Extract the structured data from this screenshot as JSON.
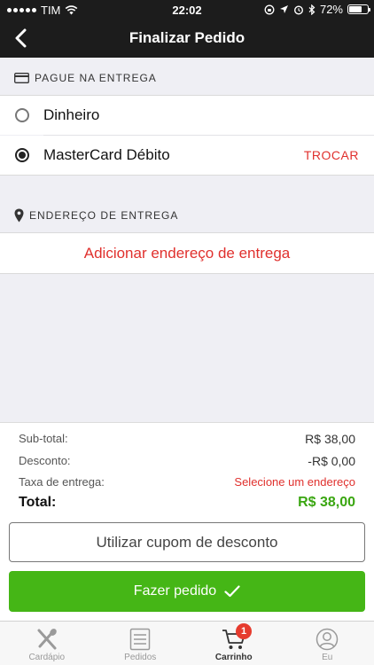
{
  "status_bar": {
    "carrier": "TIM",
    "time": "22:02",
    "battery": "72%",
    "battery_level": 0.72
  },
  "header": {
    "title": "Finalizar Pedido",
    "back_icon": "chevron-left-icon"
  },
  "payment": {
    "section_title": "PAGUE NA ENTREGA",
    "section_icon": "credit-card-icon",
    "options": [
      {
        "label": "Dinheiro",
        "selected": false
      },
      {
        "label": "MasterCard Débito",
        "selected": true,
        "action": "TROCAR"
      }
    ]
  },
  "address": {
    "section_title": "ENDEREÇO DE ENTREGA",
    "section_icon": "map-pin-icon",
    "add_label": "Adicionar endereço de entrega"
  },
  "summary": {
    "subtotal_label": "Sub-total:",
    "subtotal_value": "R$ 38,00",
    "discount_label": "Desconto:",
    "discount_value": "-R$ 0,00",
    "delivery_label": "Taxa de entrega:",
    "delivery_value": "Selecione um endereço",
    "total_label": "Total:",
    "total_value": "R$ 38,00"
  },
  "actions": {
    "coupon_label": "Utilizar cupom de desconto",
    "order_label": "Fazer pedido"
  },
  "tabbar": {
    "tabs": [
      {
        "label": "Cardápio",
        "icon": "utensils-icon",
        "active": false
      },
      {
        "label": "Pedidos",
        "icon": "list-icon",
        "active": false
      },
      {
        "label": "Carrinho",
        "icon": "cart-icon",
        "active": true,
        "badge": "1"
      },
      {
        "label": "Eu",
        "icon": "user-icon",
        "active": false
      }
    ]
  },
  "colors": {
    "accent_red": "#e0302d",
    "success_green": "#45b616",
    "total_green": "#3aa611",
    "header_bg": "#1c1c1c"
  }
}
